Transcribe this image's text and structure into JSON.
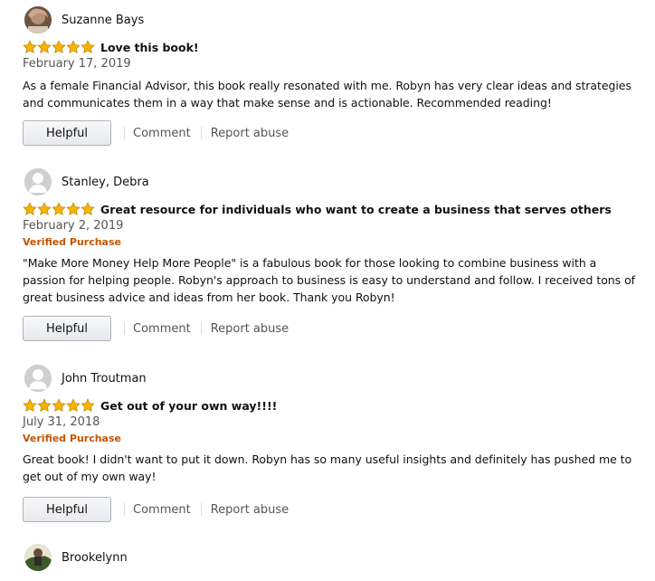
{
  "colors": {
    "star": "#f4b400",
    "verified": "#c45500",
    "button_border": "#adb1b8"
  },
  "reviews": [
    {
      "name": "Suzanne Bays",
      "avatar": "photo",
      "rating": 5,
      "title": "Love this book!",
      "date": "February 17, 2019",
      "verified": "",
      "body": "As a female Financial Advisor, this book really resonated with me. Robyn has very clear ideas and strategies and communicates them in a way that make sense and is actionable. Recommended reading!"
    },
    {
      "name": "Stanley, Debra",
      "avatar": "default",
      "rating": 5,
      "title": "Great resource for individuals who want to create a business that serves others",
      "date": "February 2, 2019",
      "verified": "Verified Purchase",
      "body": "\"Make More Money Help More People\" is a fabulous book for those looking to combine business with a passion for helping people. Robyn's approach to business is easy to understand and follow. I received tons of great business advice and ideas from her book. Thank you Robyn!"
    },
    {
      "name": "John Troutman",
      "avatar": "default",
      "rating": 5,
      "title": "Get out of your own way!!!!",
      "date": "July 31, 2018",
      "verified": "Verified Purchase",
      "body": "Great book! I didn't want to put it down. Robyn has so many useful insights and definitely has pushed me to get out of my own way!"
    },
    {
      "name": "Brookelynn",
      "avatar": "photo2"
    }
  ],
  "actions": {
    "helpful": "Helpful",
    "comment": "Comment",
    "report": "Report abuse"
  }
}
